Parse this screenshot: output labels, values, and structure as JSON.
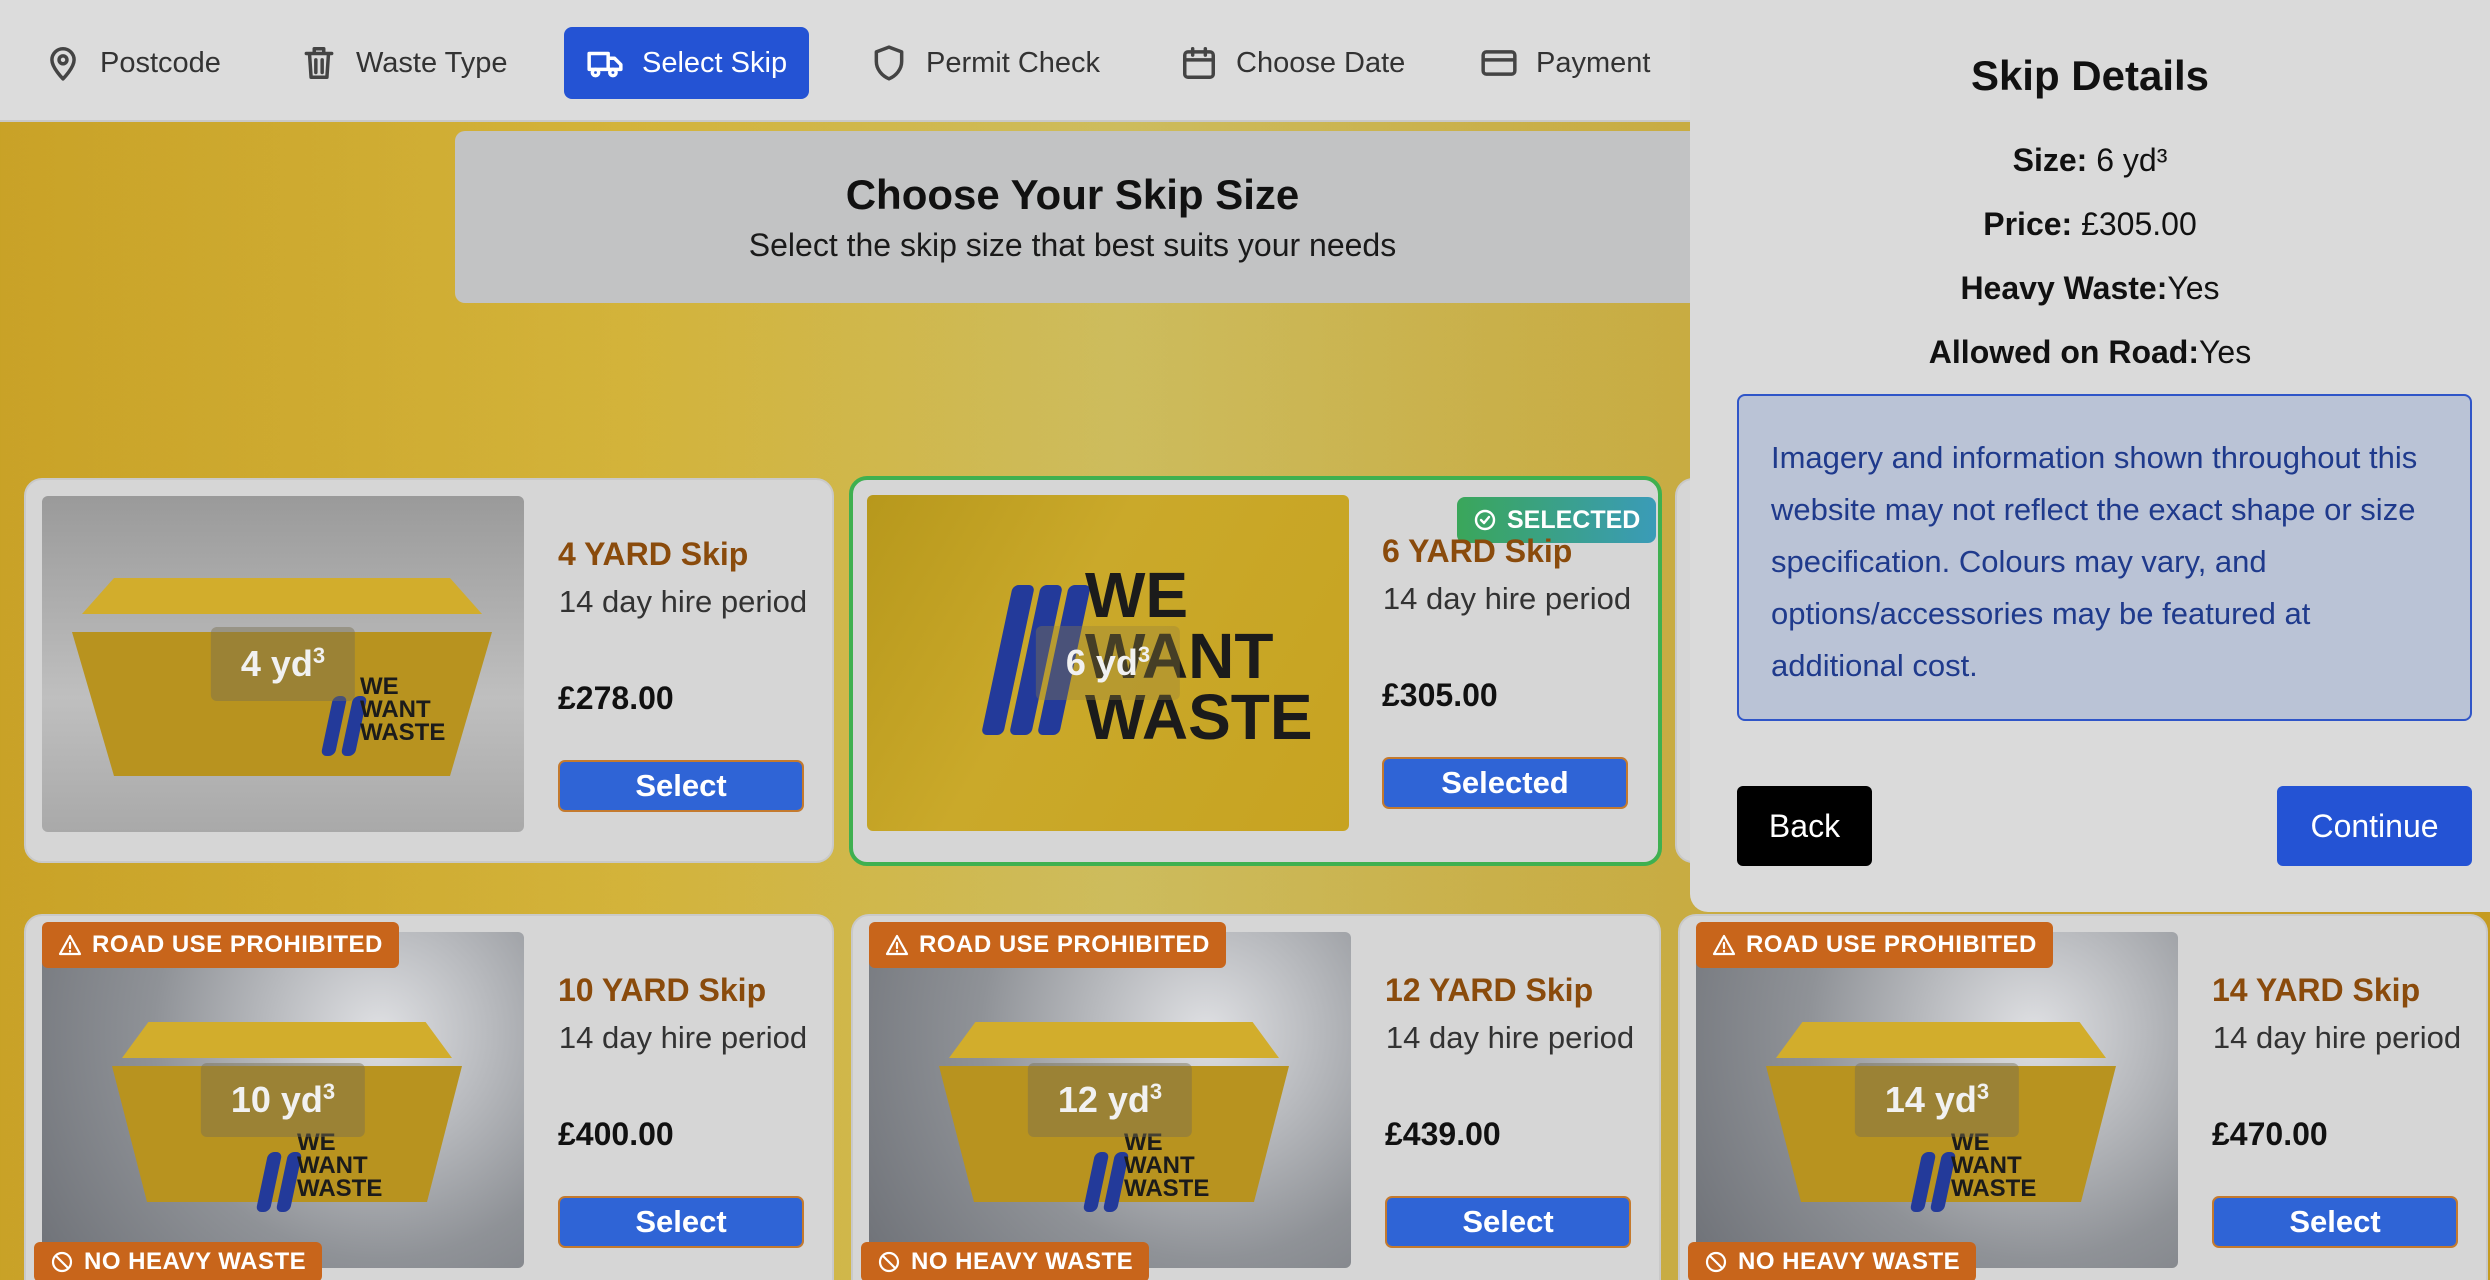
{
  "nav": {
    "steps": [
      {
        "label": "Postcode",
        "icon": "map-pin-icon"
      },
      {
        "label": "Waste Type",
        "icon": "trash-icon"
      },
      {
        "label": "Select Skip",
        "icon": "truck-icon"
      },
      {
        "label": "Permit Check",
        "icon": "shield-icon"
      },
      {
        "label": "Choose Date",
        "icon": "calendar-icon"
      },
      {
        "label": "Payment",
        "icon": "credit-card-icon"
      }
    ],
    "active": "Select Skip"
  },
  "header": {
    "title": "Choose Your Skip Size",
    "subtitle": "Select the skip size that best suits your needs"
  },
  "skips": [
    {
      "title": "4 YARD Skip",
      "size": "4 yd",
      "period": "14 day hire period",
      "price": "£278.00",
      "button": "Select"
    },
    {
      "title": "6 YARD Skip",
      "size": "6 yd",
      "period": "14 day hire period",
      "price": "£305.00",
      "button": "Selected",
      "badge": "SELECTED"
    },
    {
      "title": "10 YARD Skip",
      "size": "10 yd",
      "period": "14 day hire period",
      "price": "£400.00",
      "button": "Select",
      "warning": "ROAD USE PROHIBITED",
      "heavy": "NO HEAVY WASTE"
    },
    {
      "title": "12 YARD Skip",
      "size": "12 yd",
      "period": "14 day hire period",
      "price": "£439.00",
      "button": "Select",
      "warning": "ROAD USE PROHIBITED",
      "heavy": "NO HEAVY WASTE"
    },
    {
      "title": "14 YARD Skip",
      "size": "14 yd",
      "period": "14 day hire period",
      "price": "£470.00",
      "button": "Select",
      "warning": "ROAD USE PROHIBITED",
      "heavy": "NO HEAVY WASTE"
    }
  ],
  "size_superscript": "3",
  "logo": {
    "line1": "WE",
    "line2": "WANT",
    "line3": "WASTE"
  },
  "panel": {
    "title": "Skip Details",
    "size_label": "Size:",
    "size_value": "6 yd³",
    "price_label": "Price:",
    "price_value": "£305.00",
    "heavy_label": "Heavy Waste:",
    "heavy_value": "Yes",
    "road_label": "Allowed on Road:",
    "road_value": "Yes",
    "notice": "Imagery and information shown throughout this website may not reflect the exact shape or size specification. Colours may vary, and options/accessories may be featured at additional cost.",
    "back": "Back",
    "continue": "Continue"
  },
  "colors": {
    "primary": "#2453d4",
    "selected_border": "#3fb050",
    "warning": "#c8651b",
    "title_brown": "#8a4b0c"
  }
}
